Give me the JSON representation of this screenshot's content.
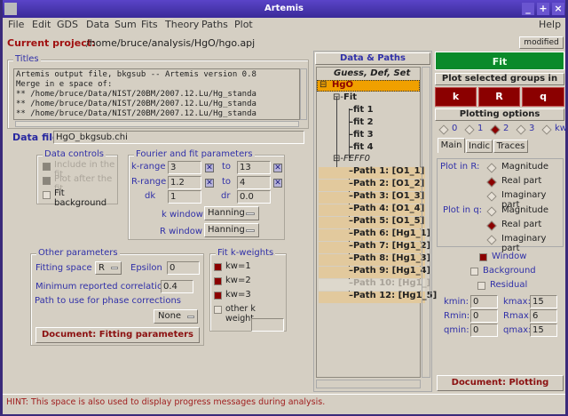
{
  "window": {
    "title": "Artemis"
  },
  "menu": {
    "items": [
      "File",
      "Edit",
      "GDS",
      "Data",
      "Sum",
      "Fits",
      "Theory",
      "Paths",
      "Plot"
    ],
    "help": "Help"
  },
  "project": {
    "label": "Current project:",
    "path": "/home/bruce/analysis/HgO/hgo.apj",
    "status": "modified"
  },
  "titles": {
    "legend": "Titles",
    "lines": [
      "Artemis output file, bkgsub -- Artemis version 0.8",
      "Merge in e space of:",
      "** /home/bruce/Data/NIST/20BM/2007.12.Lu/Hg_standa",
      "** /home/bruce/Data/NIST/20BM/2007.12.Lu/Hg_standa",
      "** /home/bruce/Data/NIST/20BM/2007.12.Lu/Hg_standa"
    ]
  },
  "datafile": {
    "label": "Data file",
    "value": "HgO_bkgsub.chi"
  },
  "data_controls": {
    "legend": "Data controls",
    "include": "Include in the fit",
    "plot_after": "Plot after the fit",
    "fit_bkg": "Fit background"
  },
  "fourier": {
    "legend": "Fourier and fit parameters",
    "krange_label": "k-range",
    "kmin": "3",
    "to": "to",
    "kmax": "13",
    "rrange_label": "R-range",
    "rmin": "1.2",
    "rmax": "4",
    "dk_label": "dk",
    "dk": "1",
    "dr_label": "dr",
    "dr": "0.0",
    "kwin_label": "k window",
    "kwin": "Hanning",
    "rwin_label": "R window",
    "rwin": "Hanning",
    "x": "✕"
  },
  "other": {
    "legend": "Other parameters",
    "fitspace_label": "Fitting space",
    "fitspace": "R",
    "epsilon_label": "Epsilon",
    "epsilon": "0",
    "mincorr_label": "Minimum reported correlation",
    "mincorr": "0.4",
    "phase_label": "Path to use for phase corrections",
    "phase": "None",
    "doc_button": "Document: Fitting parameters"
  },
  "kweights": {
    "legend": "Fit k-weights",
    "kw1": "kw=1",
    "kw2": "kw=2",
    "kw3": "kw=3",
    "other": "other k weight"
  },
  "hint": "HINT: This space is also used to display progress messages during analysis.",
  "tree": {
    "header": "Data & Paths",
    "gds": "Guess, Def, Set",
    "hgo": "HgO",
    "fit": "Fit",
    "fits": [
      "fit 1",
      "fit 2",
      "fit 3",
      "fit 4"
    ],
    "feff": "FEFF0",
    "paths": [
      "Path 1: [O1_1]",
      "Path 2: [O1_2]",
      "Path 3: [O1_3]",
      "Path 4: [O1_4]",
      "Path 5: [O1_5]",
      "Path 6: [Hg1_1]",
      "Path 7: [Hg1_2]",
      "Path 8: [Hg1_3]",
      "Path 9: [Hg1_4]",
      "Path 10: [Hg1_]",
      "Path 12: [Hg1_5]"
    ]
  },
  "plot": {
    "fit": "Fit",
    "selected_label": "Plot selected groups in",
    "k": "k",
    "R": "R",
    "q": "q",
    "options_label": "Plotting options",
    "kw_options": [
      "0",
      "1",
      "2",
      "3",
      "kw"
    ],
    "kw_selected": "2",
    "tabs": [
      "Main",
      "Indic",
      "Traces"
    ],
    "plot_in_r": "Plot in R:",
    "plot_in_q": "Plot in q:",
    "magnitude": "Magnitude",
    "real": "Real part",
    "imag": "Imaginary part",
    "window": "Window",
    "background": "Background",
    "residual": "Residual",
    "kmin_label": "kmin:",
    "kmin": "0",
    "kmax_label": "kmax:",
    "kmax": "15",
    "rmin_label": "Rmin:",
    "rmin": "0",
    "rmax_label": "Rmax:",
    "rmax": "6",
    "qmin_label": "qmin:",
    "qmin": "0",
    "qmax_label": "qmax:",
    "qmax": "15",
    "doc_button": "Document: Plotting"
  },
  "colors": {
    "accent_red": "#8b0000",
    "fit_green": "#0a8a2a",
    "title_purple": "#4a36b8",
    "highlight": "#f0a000"
  }
}
